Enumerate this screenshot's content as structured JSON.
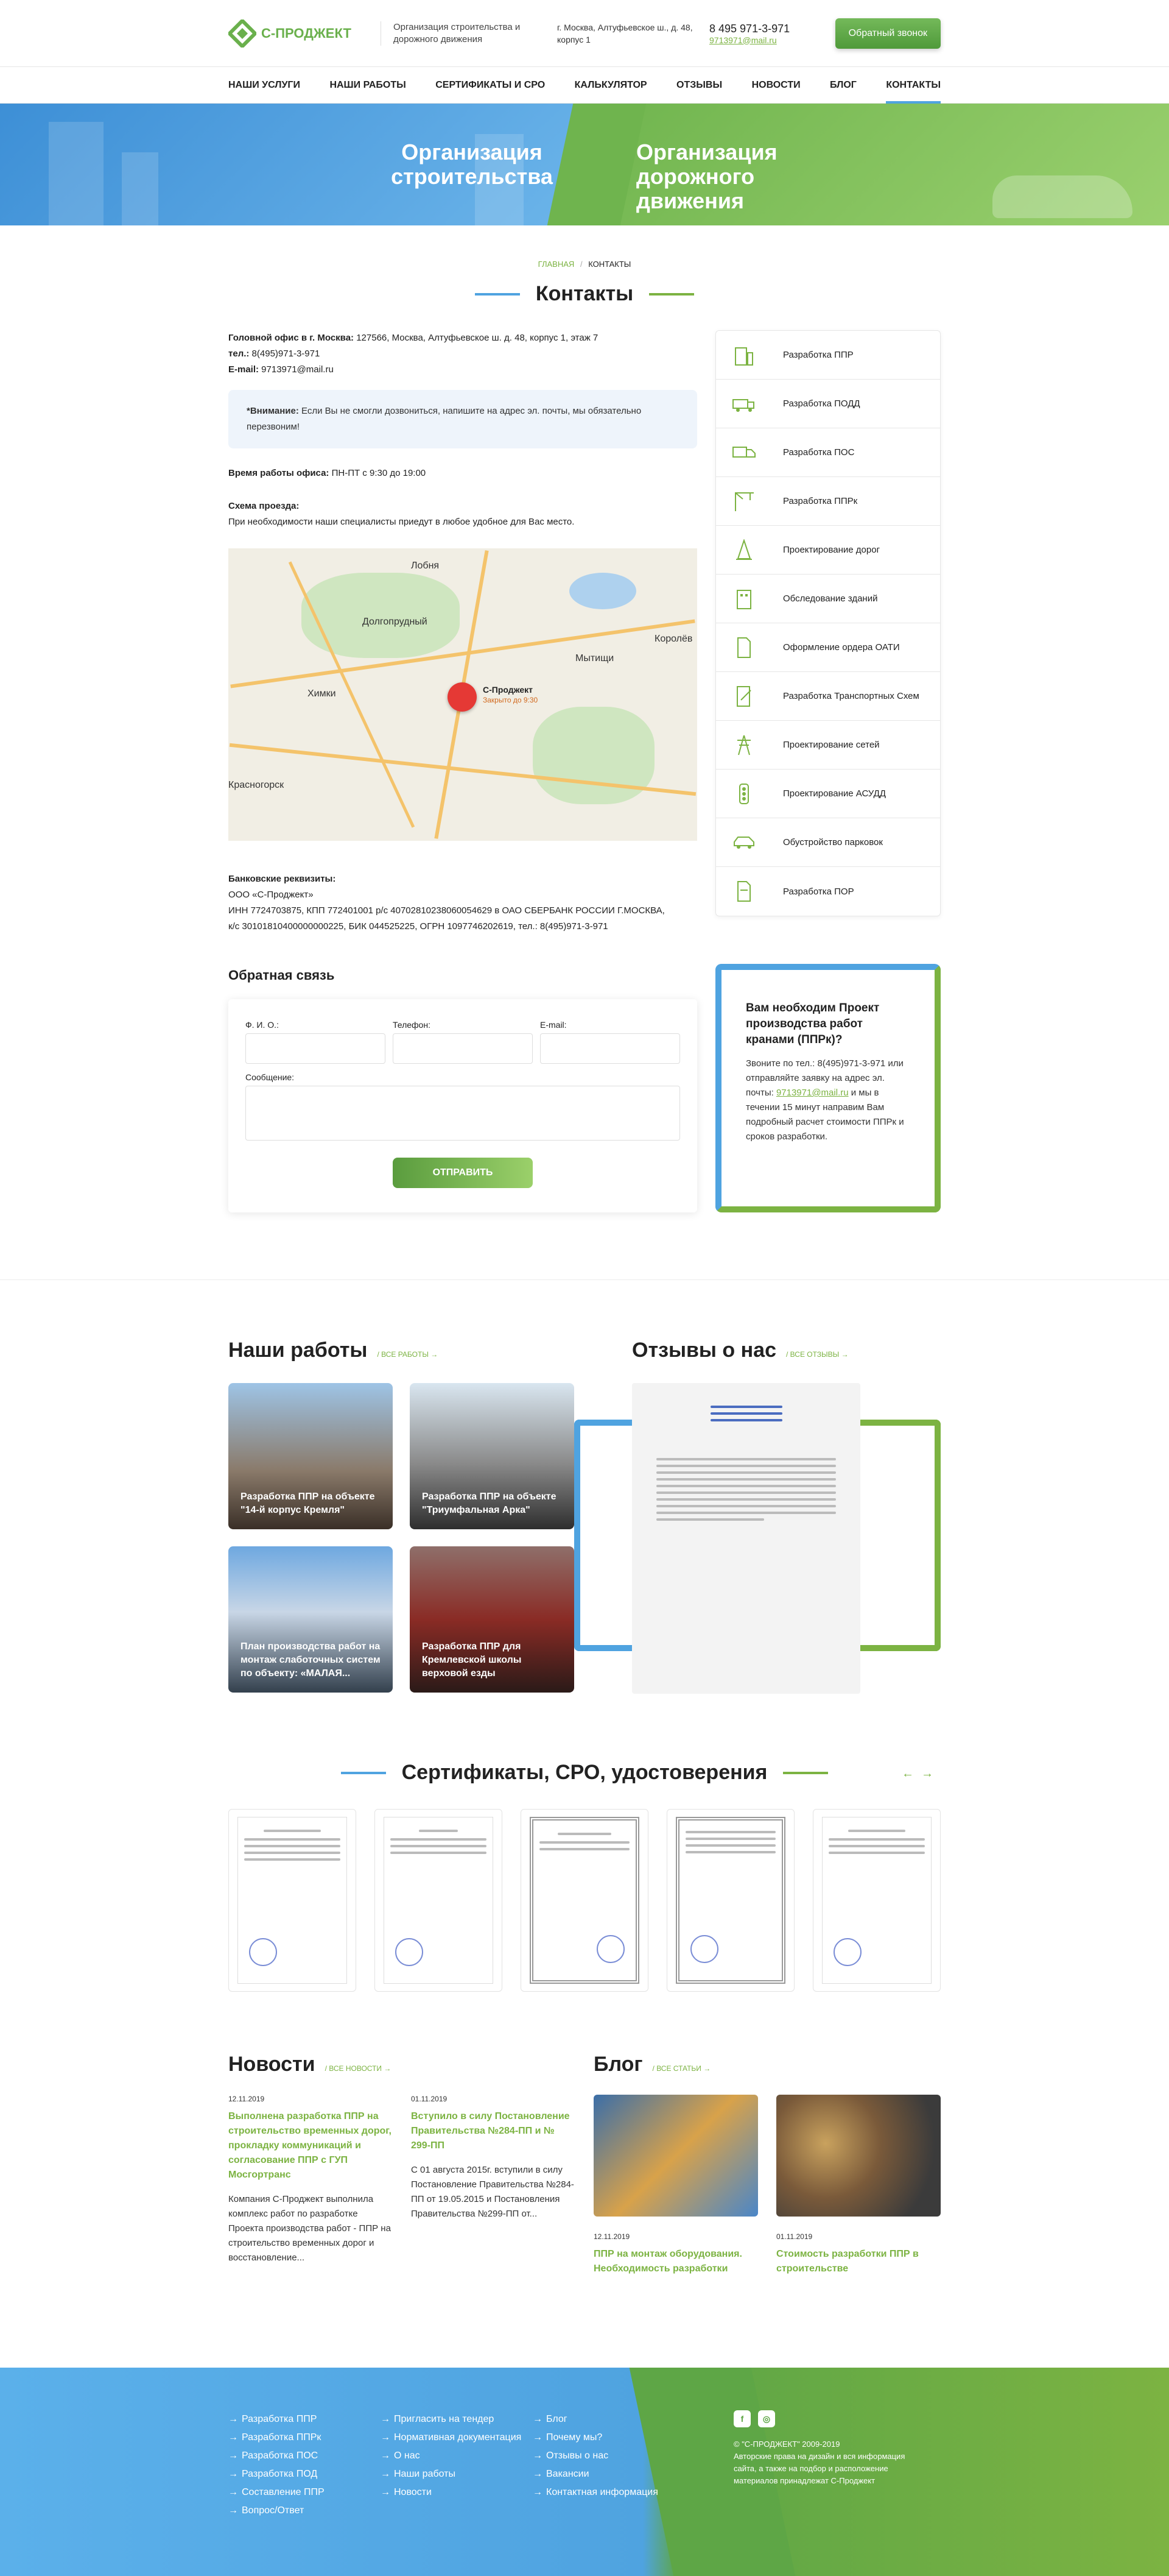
{
  "header": {
    "logo": "С-ПРОДЖЕКТ",
    "tagline": "Организация строительства и дорожного движения",
    "address": "г. Москва, Алтуфьевское ш., д. 48, корпус 1",
    "phone": "8 495 971-3-971",
    "email": "9713971@mail.ru",
    "callback": "Обратный звонок"
  },
  "nav": [
    "НАШИ УСЛУГИ",
    "НАШИ РАБОТЫ",
    "СЕРТИФИКАТЫ И СРО",
    "КАЛЬКУЛЯТОР",
    "ОТЗЫВЫ",
    "НОВОСТИ",
    "БЛОГ",
    "КОНТАКТЫ"
  ],
  "banner": {
    "left": "Организация строительства",
    "right": "Организация дорожного движения"
  },
  "breadcrumb": {
    "home": "ГЛАВНАЯ",
    "current": "КОНТАКТЫ"
  },
  "page_title": "Контакты",
  "contacts": {
    "office_label": "Головной офис в г. Москва:",
    "office_value": " 127566, Москва, Алтуфьевское ш. д. 48, корпус 1, этаж 7",
    "tel_label": "тел.:",
    "tel_value": " 8(495)971-3-971",
    "email_label": "E-mail:",
    "email_value": " 9713971@mail.ru",
    "alert_label": "*Внимание:",
    "alert_text": " Если Вы не смогли дозвониться, напишите на адрес эл. почты, мы обязательно перезвоним!",
    "hours_label": "Время работы офиса:",
    "hours_value": " ПН-ПТ с 9:30 до 19:00",
    "route_label": "Схема проезда:",
    "route_text": "При необходимости наши специалисты приедут в любое удобное для Вас место."
  },
  "map": {
    "cities": [
      "Долгопрудный",
      "Химки",
      "Мытищи",
      "Лобня",
      "Королёв",
      "Красногорск"
    ],
    "marker_title": "С-Проджект",
    "marker_sub": "Закрыто до 9:30"
  },
  "bank": {
    "label": "Банковские реквизиты:",
    "line1": "ООО «С-Проджект»",
    "line2": "ИНН 7724703875, КПП 772401001 р/с 40702810238060054629 в ОАО СБЕРБАНК РОССИИ Г.МОСКВА,",
    "line3": "к/с 30101810400000000225, БИК 044525225, ОГРН 1097746202619, тел.: 8(495)971-3-971"
  },
  "services": [
    "Разработка ППР",
    "Разработка ПОДД",
    "Разработка ПОС",
    "Разработка ППРк",
    "Проектирование дорог",
    "Обследование зданий",
    "Оформление ордера ОАТИ",
    "Разработка Транспортных Схем",
    "Проектирование сетей",
    "Проектирование АСУДД",
    "Обустройство парковок",
    "Разработка ПОР"
  ],
  "feedback": {
    "title": "Обратная связь",
    "name_label": "Ф. И. О.:",
    "phone_label": "Телефон:",
    "email_label": "E-mail:",
    "message_label": "Сообщение:",
    "send": "ОТПРАВИТЬ"
  },
  "promo": {
    "title": "Вам необходим Проект производства работ кранами (ППРк)?",
    "text_a": "Звоните по тел.: 8(495)971-3-971 или отправляйте заявку на адрес эл. почты: ",
    "text_email": "9713971@mail.ru",
    "text_b": " и мы в течении 15 минут направим Вам подробный расчет стоимости ППРк и сроков разработки."
  },
  "works": {
    "title": "Наши работы",
    "all": "/ ВСЕ РАБОТЫ  →",
    "items": [
      "Разработка ППР на объекте \"14-й корпус Кремля\"",
      "Разработка ППР на объекте \"Триумфальная Арка\"",
      "План производства работ на монтаж слаботочных систем по объекту: «МАЛАЯ...",
      "Разработка ППР для Кремлевской школы верховой езды"
    ]
  },
  "reviews": {
    "title": "Отзывы о нас",
    "all": "/ ВСЕ ОТЗЫВЫ  →"
  },
  "certs": {
    "title": "Сертификаты, СРО, удостоверения",
    "prev": "←",
    "next": "→"
  },
  "news": {
    "title": "Новости",
    "all": "/ ВСЕ НОВОСТИ  →",
    "items": [
      {
        "date": "12.11.2019",
        "title": "Выполнена разработка ППР на строительство временных дорог, прокладку коммуникаций и согласование ППР с ГУП Мосгортранс",
        "text": "Компания С-Проджект выполнила комплекс работ по разработке Проекта производства работ - ППР на строительство временных дорог и восстановление..."
      },
      {
        "date": "01.11.2019",
        "title": "Вступило в силу Постановление Правительства №284-ПП и № 299-ПП",
        "text": "С 01 августа 2015г. вступили в силу Постановление Правительства №284-ПП от 19.05.2015 и Постановления Правительства №299-ПП от..."
      }
    ]
  },
  "blog": {
    "title": "Блог",
    "all": "/ ВСЕ СТАТЬИ  →",
    "items": [
      {
        "date": "12.11.2019",
        "title": "ППР на монтаж оборудования. Необходимость разработки"
      },
      {
        "date": "01.11.2019",
        "title": "Стоимость разработки ППР в строительстве"
      }
    ]
  },
  "footer": {
    "col1": [
      "Разработка ППР",
      "Разработка ППРк",
      "Разработка ПОС",
      "Разработка ПОД",
      "Составление ППР",
      "Вопрос/Ответ"
    ],
    "col2": [
      "Пригласить на тендер",
      "Нормативная документация",
      "О нас",
      "Наши работы",
      "Новости"
    ],
    "col3": [
      "Блог",
      "Почему мы?",
      "Отзывы о нас",
      "Вакансии",
      "Контактная информация"
    ],
    "copyright": "© \"С-ПРОДЖЕКТ\" 2009-2019",
    "rights": "Авторские права на дизайн и вся информация сайта, а также на подбор и расположение материалов принадлежат С-Проджект"
  },
  "colors": {
    "blue": "#4fa3e0",
    "green": "#7cb342"
  }
}
